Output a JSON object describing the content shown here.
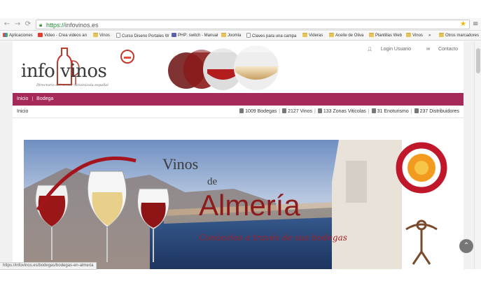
{
  "browser": {
    "url_scheme": "https://",
    "url_rest": "infovinos.es",
    "back_icon": "←",
    "forward_icon": "→",
    "reload_icon": "⟳",
    "star_icon": "★",
    "menu_icon": "≡"
  },
  "bookmarks": [
    {
      "label": "Aplicaciones",
      "icon": "apps"
    },
    {
      "label": "Video - Crea videos an",
      "icon": "yt"
    },
    {
      "label": "Vinos",
      "icon": "folder"
    },
    {
      "label": "Curso Diseno Portales W",
      "icon": "page"
    },
    {
      "label": "PHP: switch - Manual",
      "icon": "php"
    },
    {
      "label": "Joomla",
      "icon": "folder"
    },
    {
      "label": "Claves para una campa",
      "icon": "page"
    },
    {
      "label": "Videras",
      "icon": "folder"
    },
    {
      "label": "Aceite de Oliva",
      "icon": "folder"
    },
    {
      "label": "Plantillas Web",
      "icon": "folder"
    },
    {
      "label": "Vinos",
      "icon": "folder"
    },
    {
      "label": "»",
      "icon": ""
    },
    {
      "label": "Otros marcadores",
      "icon": "folder"
    }
  ],
  "site": {
    "logo_text": "info vinos",
    "logo_tagline": "Directorio del sector vitivinícola español",
    "login_label": "Login Usuario",
    "contact_label": "Contacto",
    "nav": [
      "Inicio",
      "Bodega"
    ],
    "breadcrumb": "Inicio",
    "stats": [
      {
        "label": "1009 Bodegas",
        "icon": "building"
      },
      {
        "label": "2127 Vinos",
        "icon": "bottle"
      },
      {
        "label": "133 Zonas Viticolas",
        "icon": "map"
      },
      {
        "label": "31 Enoturismo",
        "icon": "grape"
      },
      {
        "label": "237 Distribuidores",
        "icon": "truck"
      }
    ]
  },
  "banner": {
    "title_1": "Vinos",
    "title_2": "de",
    "title_3": "Almería",
    "subtitle": "Conócelos a través de sus bodegas"
  },
  "status_url": "https://infovinos.es/bodegas/bodegas-en-almeria",
  "colors": {
    "nav_bg": "#a52a5a",
    "banner_title": "#8e1b1b",
    "subtitle": "#a31f2a"
  }
}
